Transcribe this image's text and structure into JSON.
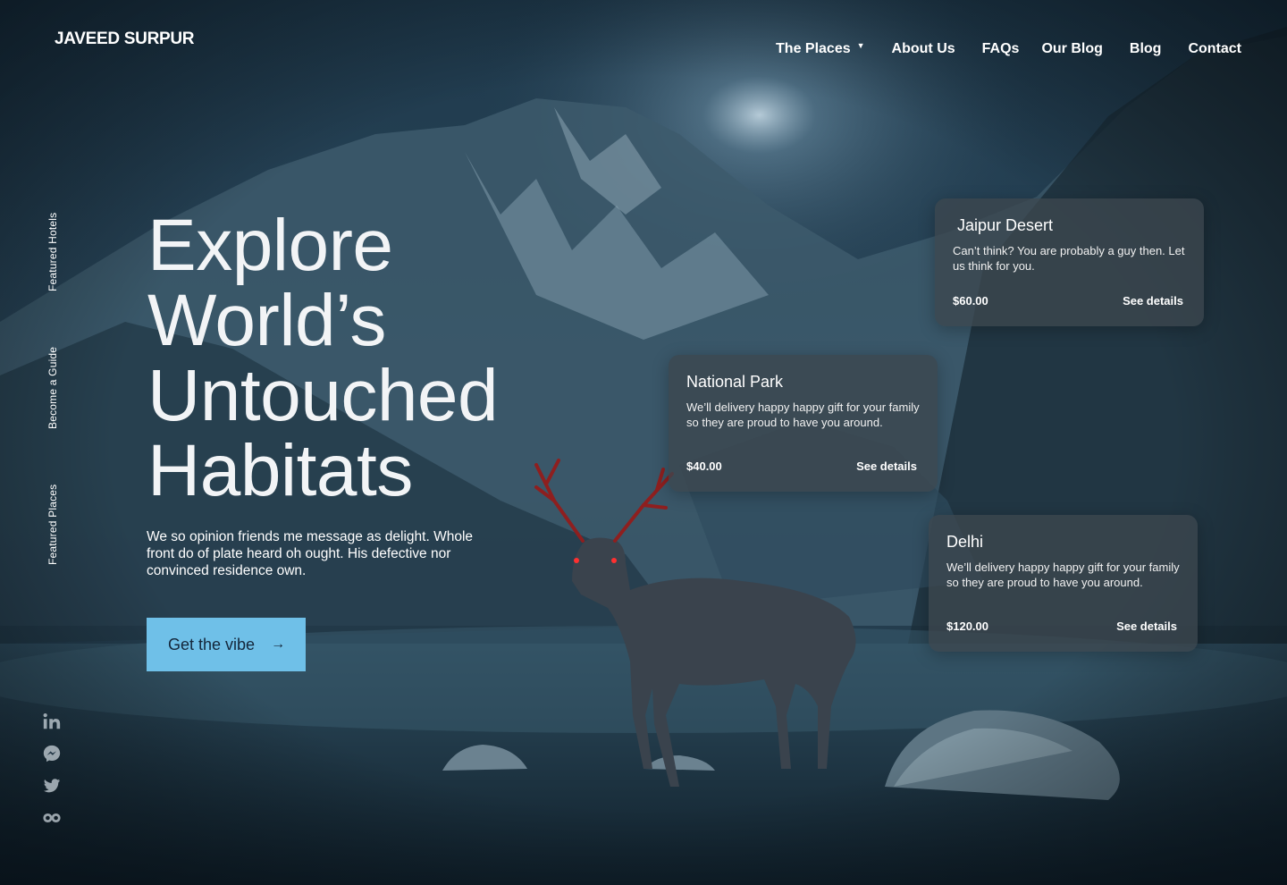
{
  "brand": {
    "name": "JAVEED SURPUR"
  },
  "nav": {
    "items": [
      {
        "label": "The Places",
        "has_dropdown": true
      },
      {
        "label": "About Us"
      },
      {
        "label": "FAQs"
      },
      {
        "label": "Our Blog"
      },
      {
        "label": "Blog"
      },
      {
        "label": "Contact"
      }
    ]
  },
  "side_links": [
    "Featured Hotels",
    "Become a Guide",
    "Featured Places"
  ],
  "socials": [
    "linkedin-icon",
    "messenger-icon",
    "twitter-icon",
    "flickr-icon"
  ],
  "hero": {
    "title_lines": [
      "Explore",
      "World’s",
      "Untouched",
      "Habitats"
    ],
    "description": "We so opinion friends me message as delight. Whole front do of plate heard oh ought. His defective nor convinced residence own.",
    "cta_label": "Get the vibe"
  },
  "cards": [
    {
      "title": "Jaipur Desert",
      "description": "Can’t think? You are probably a guy then. Let us think for you.",
      "price": "$60.00",
      "link": "See details"
    },
    {
      "title": "National Park",
      "description": "We’ll delivery happy happy gift for your family so they are proud to have you around.",
      "price": "$40.00",
      "link": "See details"
    },
    {
      "title": "Delhi",
      "description": "We’ll delivery happy happy gift for your family so they are proud to have you around.",
      "price": "$120.00",
      "link": "See details"
    }
  ],
  "colors": {
    "accent": "#6fc0e8",
    "background": "#1b2f3e",
    "card_bg": "#3c464e"
  }
}
